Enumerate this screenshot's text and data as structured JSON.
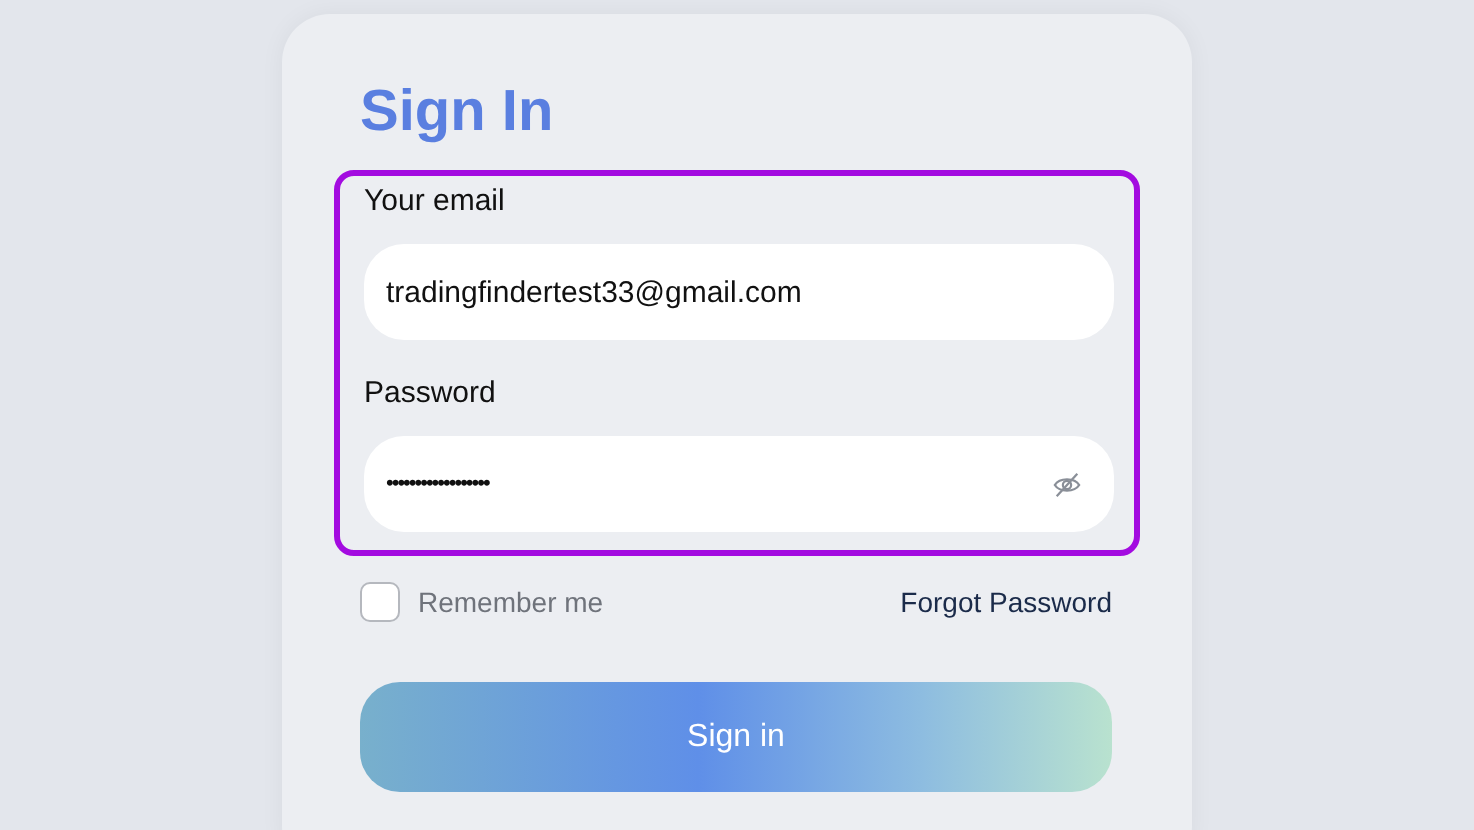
{
  "title": "Sign In",
  "highlight": true,
  "fields": [
    {
      "label": "Your email",
      "value": "tradingfindertest33@gmail.com",
      "kind": "text"
    },
    {
      "label": "Password",
      "value": "••••••••••••••••••",
      "kind": "password"
    }
  ],
  "remember": {
    "label": "Remember me",
    "checked": false
  },
  "forgot_link": "Forgot Password",
  "submit_button": "Sign in"
}
